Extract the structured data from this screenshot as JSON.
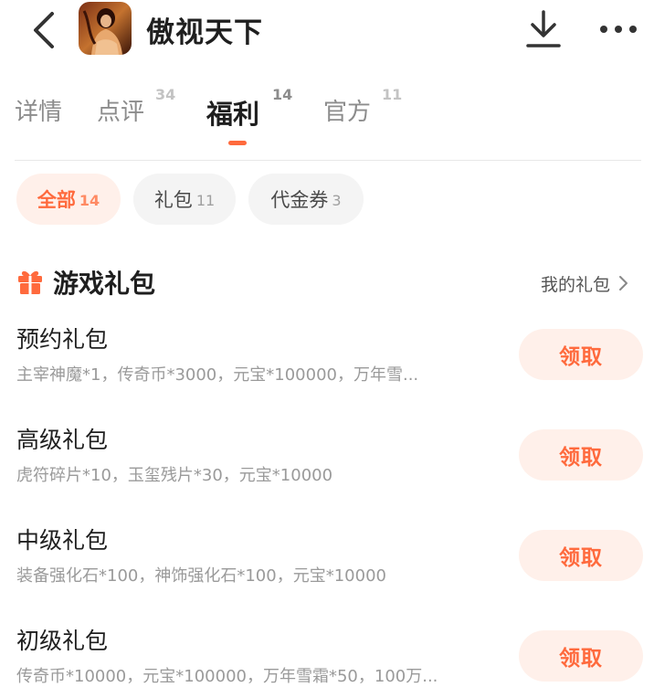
{
  "header": {
    "title": "傲视天下",
    "back_icon": "chevron-left-icon",
    "download_icon": "download-icon",
    "more_icon": "more-dots-icon",
    "game_icon": "game-cover-image"
  },
  "tabs": [
    {
      "label": "详情",
      "count": ""
    },
    {
      "label": "点评",
      "count": "34"
    },
    {
      "label": "福利",
      "count": "14",
      "active": true
    },
    {
      "label": "官方",
      "count": "11"
    }
  ],
  "filters": [
    {
      "label": "全部",
      "count": "14",
      "active": true
    },
    {
      "label": "礼包",
      "count": "11"
    },
    {
      "label": "代金券",
      "count": "3"
    }
  ],
  "section": {
    "title": "游戏礼包",
    "link_label": "我的礼包",
    "icon": "gift-icon"
  },
  "gifts": [
    {
      "name": "预约礼包",
      "desc": "主宰神魔*1，传奇币*3000，元宝*100000，万年雪...",
      "button": "领取"
    },
    {
      "name": "高级礼包",
      "desc": "虎符碎片*10，玉玺残片*30，元宝*10000",
      "button": "领取"
    },
    {
      "name": "中级礼包",
      "desc": "装备强化石*100，神饰强化石*100，元宝*10000",
      "button": "领取"
    },
    {
      "name": "初级礼包",
      "desc": "传奇币*10000，元宝*100000，万年雪霜*50，100万...",
      "button": "领取"
    }
  ],
  "colors": {
    "accent": "#ff6a3d",
    "accent_bg": "#fff0ea",
    "chip_bg": "#f4f4f4",
    "text_primary": "#1f1f1f",
    "text_secondary": "#9a9a9a"
  }
}
